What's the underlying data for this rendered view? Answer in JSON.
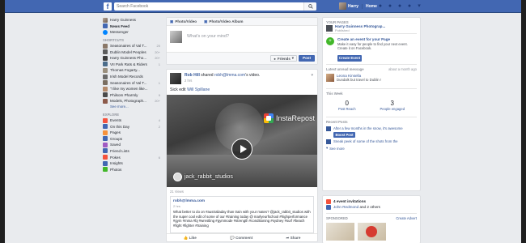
{
  "topbar": {
    "logo": "f",
    "search_placeholder": "Search Facebook",
    "user_name": "Harry",
    "home_label": "Home"
  },
  "sidebar": {
    "profile_name": "Harry Guinness",
    "main": [
      {
        "label": "News Feed",
        "color": "#4267b2",
        "active": true
      },
      {
        "label": "Messenger",
        "color": "#0084ff",
        "active": false
      }
    ],
    "shortcuts_title": "SHORTCUTS",
    "shortcuts": [
      {
        "label": "Seasonaires of Val T...",
        "count": "20"
      },
      {
        "label": "Dublin Model Peoples",
        "count": "20+"
      },
      {
        "label": "Harry Guinness Pho...",
        "count": "20+"
      },
      {
        "label": "VII Park Rats & Riders",
        "count": "1"
      },
      {
        "label": "Thomas Fogarty...",
        "count": ""
      },
      {
        "label": "Irish Model Records",
        "count": ""
      },
      {
        "label": "Seasonaires of Val T...",
        "count": "1"
      },
      {
        "label": "\"I like my women like...",
        "count": ""
      },
      {
        "label": "Philsom Pharmly",
        "count": "9"
      },
      {
        "label": "Models, Photograph...",
        "count": "20+"
      }
    ],
    "see_more": "See more...",
    "explore_title": "EXPLORE",
    "explore": [
      {
        "label": "Events",
        "color": "#f5533d",
        "count": "4"
      },
      {
        "label": "On this Day",
        "color": "#4267b2",
        "count": "2"
      },
      {
        "label": "Pages",
        "color": "#f7923b",
        "count": ""
      },
      {
        "label": "Groups",
        "color": "#4267b2",
        "count": ""
      },
      {
        "label": "Saved",
        "color": "#a05bc3",
        "count": ""
      },
      {
        "label": "Friend Lists",
        "color": "#4267b2",
        "count": ""
      },
      {
        "label": "Pokes",
        "color": "#f5533d",
        "count": "6"
      },
      {
        "label": "Insights",
        "color": "#4267b2",
        "count": ""
      },
      {
        "label": "Photos",
        "color": "#42b72a",
        "count": ""
      }
    ]
  },
  "composer": {
    "tab_photo": "Photo/Video",
    "tab_album": "Photo/Video Album",
    "placeholder": "What's on your mind?",
    "audience": "Friends",
    "post_label": "Post"
  },
  "post": {
    "author": "Rob Hill",
    "shared_text": "shared",
    "shared_source": "robh@lmma.com",
    "shared_suffix": "'s video.",
    "time": "2 hrs",
    "text_prefix": "Sick edit",
    "text_link": "Will Spillane",
    "video": {
      "overlay_brand": "InstaRepost",
      "watermark": "jack_rabbit_studios"
    },
    "views": "21 Views",
    "shared_author": "robh@lmma.com",
    "shared_time": "2 hrs",
    "shared_body": "What better to do on #australiaday than train with your mates? @jack_rabbit_studios with the super cool edit of some of our #training today @ marlyeurfschool #highperformance #gym #mma #bj #wrestling #gymmode #strength #conditioning #sydney #surf #beach #fight #fighter #training",
    "like": "Like",
    "comment": "Comment",
    "share": "Share"
  },
  "right": {
    "your_pages": "YOUR PAGES",
    "page_name": "Harry Guinness Photograp...",
    "page_sub": "Published",
    "create_title": "Create an event for your Page",
    "create_desc": "Make it easy for people to find your next event. Create it on Facebook.",
    "create_btn": "Create Event",
    "latest_title": "Latest unread message",
    "latest_time": "about a month ago",
    "msg_name": "Leona Kinsella",
    "msg_text": "Dundalk but travel to Dublin !",
    "week_title": "This Week",
    "stat1_num": "0",
    "stat1_label": "Post Reach",
    "stat2_num": "3",
    "stat2_label": "People engaged",
    "recent_title": "Recent Posts",
    "recent1": "After a few months in the snow, it's awesome",
    "boost": "Boost Post",
    "recent2": "Sneak peek of some of the shots from the",
    "see_more": "See more",
    "events_count": "4 event invitations",
    "event_person": "John Redmond",
    "event_others": "and 2 others",
    "sponsored": "SPONSORED",
    "create_advert": "Create Advert"
  }
}
